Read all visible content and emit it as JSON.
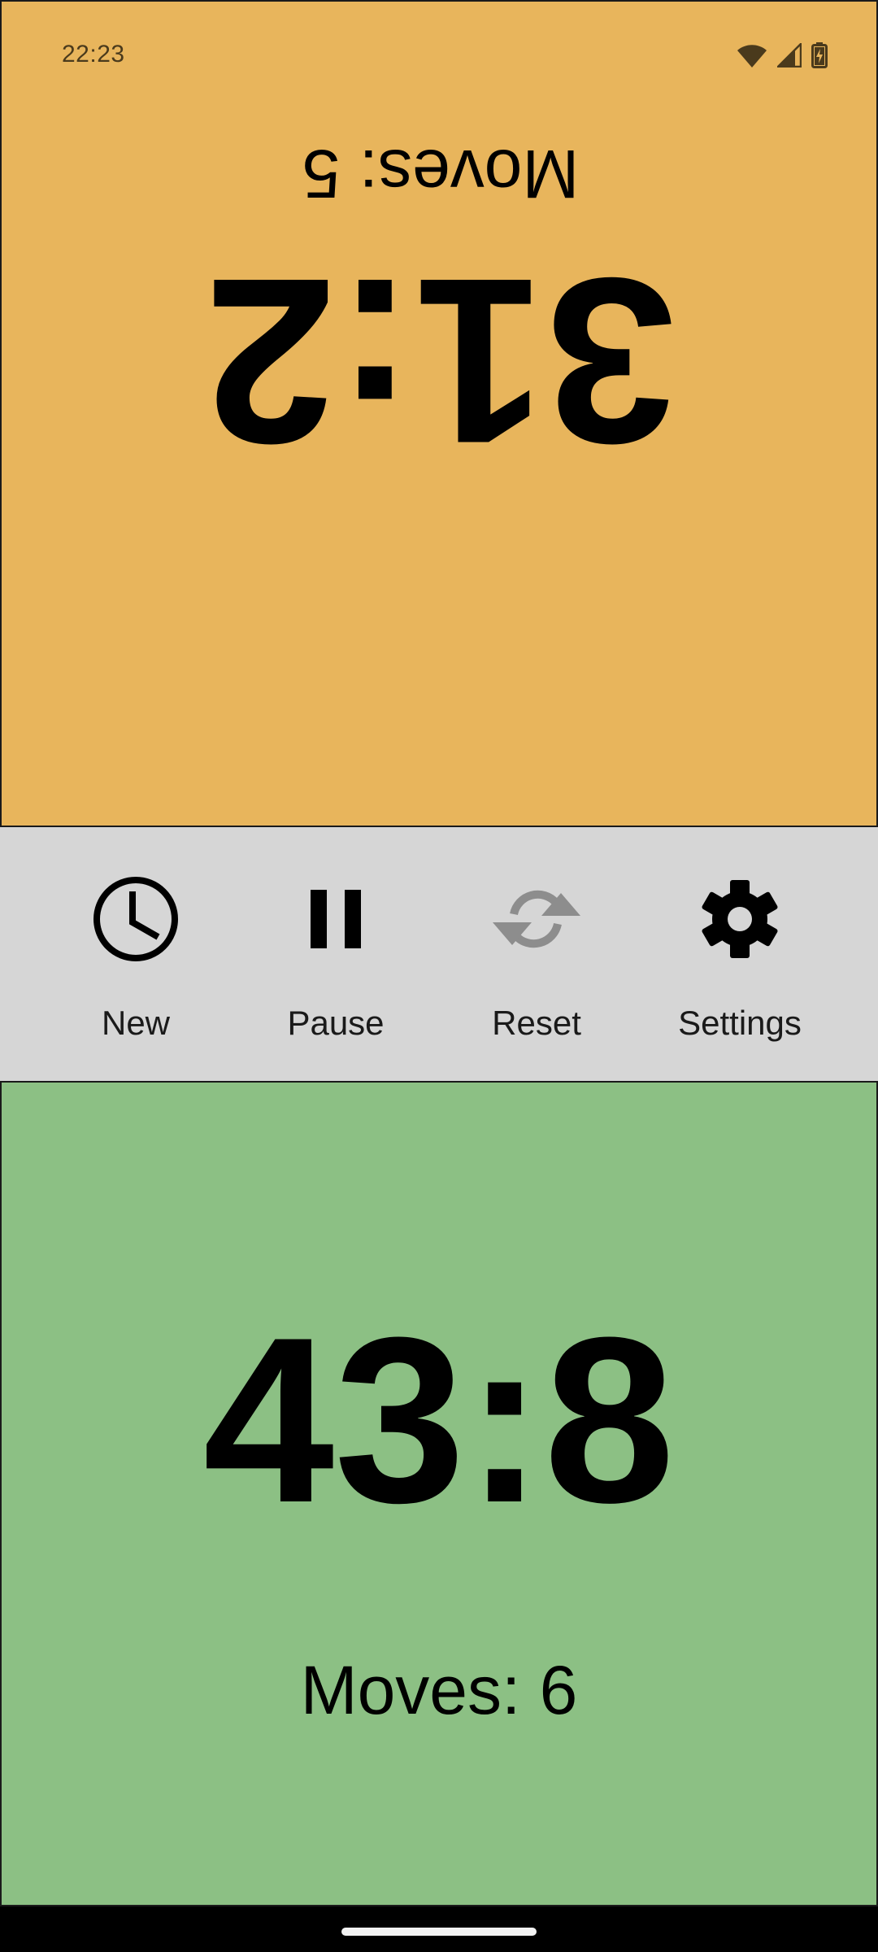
{
  "status_bar": {
    "time": "22:23",
    "icons": [
      "wifi-icon",
      "cell-signal-icon",
      "battery-charging-icon"
    ]
  },
  "top_player": {
    "clock": "31:2",
    "moves": "Moves: 5",
    "background": "#e8b55c",
    "rotated": true
  },
  "toolbar": {
    "background": "#d6d6d6",
    "items": [
      {
        "label": "New",
        "icon": "clock-icon",
        "enabled": true
      },
      {
        "label": "Pause",
        "icon": "pause-icon",
        "enabled": true
      },
      {
        "label": "Reset",
        "icon": "reset-icon",
        "enabled": false
      },
      {
        "label": "Settings",
        "icon": "gear-icon",
        "enabled": true
      }
    ]
  },
  "bottom_player": {
    "clock": "43:8",
    "moves": "Moves: 6",
    "background": "#8cc084"
  }
}
